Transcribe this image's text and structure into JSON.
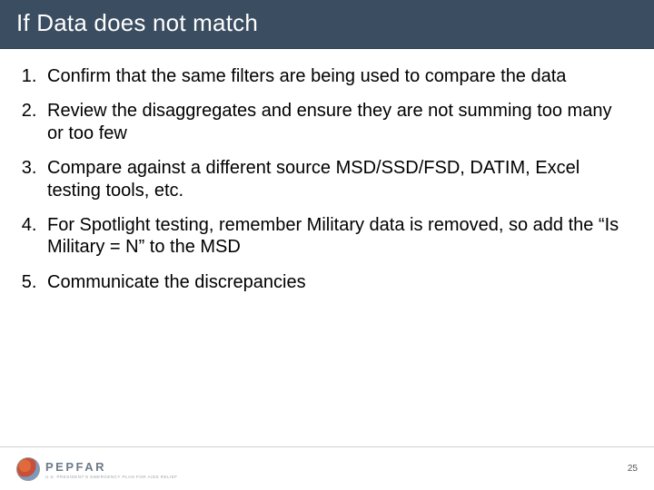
{
  "title": "If Data does not match",
  "points": [
    "Confirm that the same filters are being used to compare the data",
    "Review the disaggregates and ensure they are not summing too many or too few",
    "Compare against a different source MSD/SSD/FSD, DATIM, Excel testing tools, etc.",
    "For Spotlight testing, remember Military data is removed, so add the “Is Military = N” to the MSD",
    "Communicate the discrepancies"
  ],
  "footer": {
    "logo_text": "PEPFAR",
    "logo_sub": "U.S. PRESIDENT'S EMERGENCY PLAN FOR AIDS RELIEF",
    "page_number": "25"
  }
}
